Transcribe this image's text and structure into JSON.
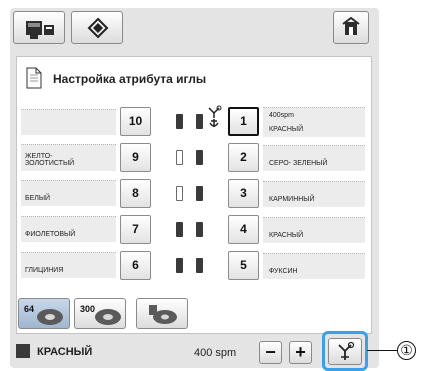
{
  "header": {
    "title": "Настройка атрибута иглы"
  },
  "rows": [
    {
      "left_label": "",
      "left_num": "10",
      "right_num": "1",
      "right_top": "400spm",
      "right_label": "КРАСНЫЙ"
    },
    {
      "left_label": "ЖЕЛТО-ЗОЛОТИСТЫЙ",
      "left_num": "9",
      "right_num": "2",
      "right_top": "",
      "right_label": "СЕРО- ЗЕЛЕНЫЙ"
    },
    {
      "left_label": "БЕЛЫЙ",
      "left_num": "8",
      "right_num": "3",
      "right_top": "",
      "right_label": "КАРМИННЫЙ"
    },
    {
      "left_label": "ФИОЛЕТОВЫЙ",
      "left_num": "7",
      "right_num": "4",
      "right_top": "",
      "right_label": "КРАСНЫЙ"
    },
    {
      "left_label": "ГЛИЦИНИЯ",
      "left_num": "6",
      "right_num": "5",
      "right_top": "",
      "right_label": "ФУКСИН"
    }
  ],
  "tabs": [
    {
      "label": "64"
    },
    {
      "label": "300"
    },
    {
      "label": ""
    }
  ],
  "bottom": {
    "color": "КРАСНЫЙ",
    "speed": "400 spm",
    "minus": "−",
    "plus": "+"
  },
  "callout_number": "①",
  "colors": {
    "spool_dark": "#3a3a3a",
    "callout": "#3aa0e8",
    "screen_bg": "#e4e4e4"
  }
}
